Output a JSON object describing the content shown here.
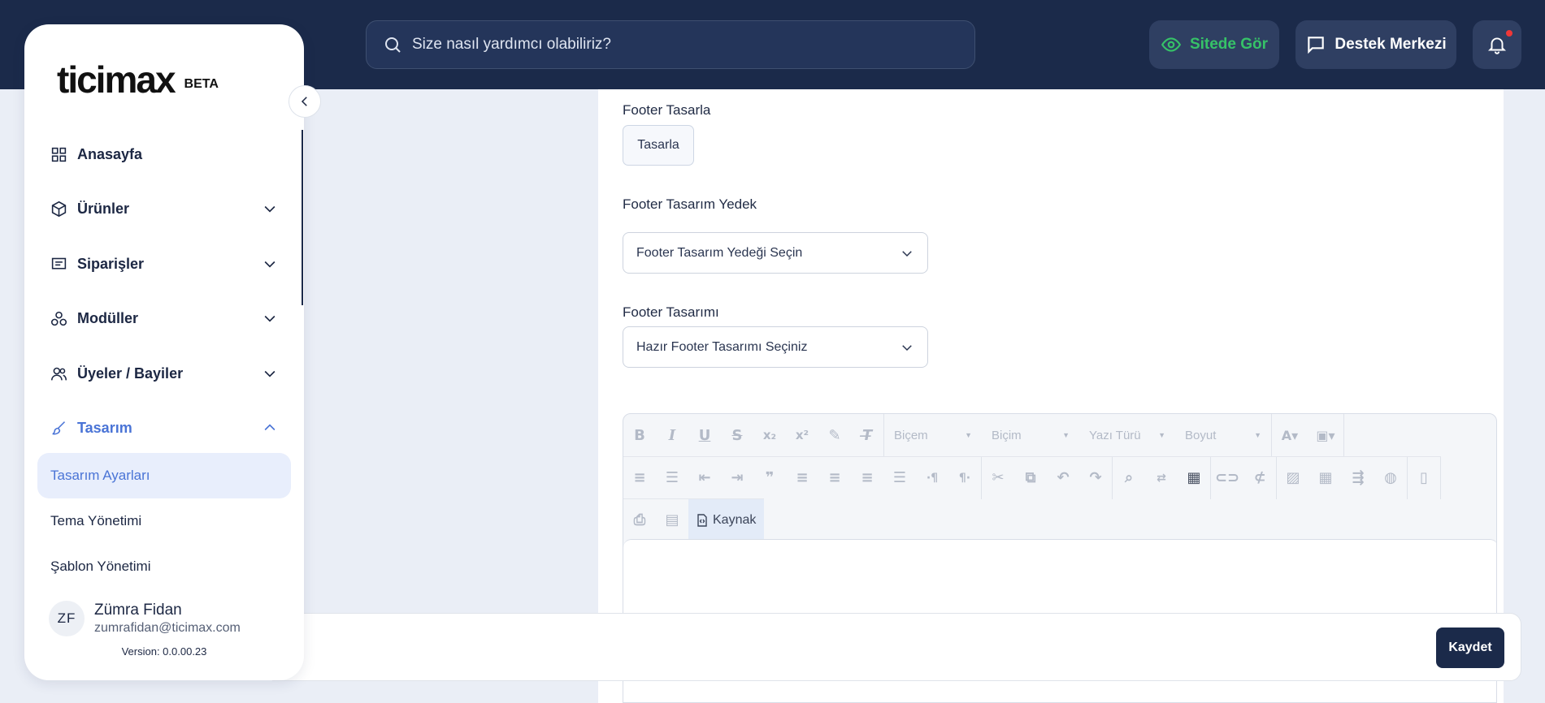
{
  "topbar": {
    "search_placeholder": "Size nasıl yardımcı olabiliriz?",
    "view_site_label": "Sitede Gör",
    "support_label": "Destek Merkezi"
  },
  "sidebar": {
    "logo_text": "ticimax",
    "beta_label": "BETA",
    "items": [
      {
        "label": "Anasayfa",
        "icon": "grid-icon",
        "expandable": false
      },
      {
        "label": "Ürünler",
        "icon": "box-icon",
        "expandable": true
      },
      {
        "label": "Siparişler",
        "icon": "list-icon",
        "expandable": true
      },
      {
        "label": "Modüller",
        "icon": "modules-icon",
        "expandable": true
      },
      {
        "label": "Üyeler / Bayiler",
        "icon": "users-icon",
        "expandable": true
      },
      {
        "label": "Tasarım",
        "icon": "brush-icon",
        "expandable": true,
        "expanded": true
      }
    ],
    "sub_items": [
      {
        "label": "Tasarım Ayarları",
        "active": true
      },
      {
        "label": "Tema Yönetimi",
        "active": false
      },
      {
        "label": "Şablon Yönetimi",
        "active": false
      }
    ],
    "user": {
      "initials": "ZF",
      "name": "Zümra Fidan",
      "email": "zumrafidan@ticimax.com"
    },
    "version": "Version: 0.0.00.23"
  },
  "form": {
    "footer_design_label": "Footer Tasarla",
    "design_button": "Tasarla",
    "backup_label": "Footer Tasarım Yedek",
    "backup_select": "Footer Tasarım Yedeği Seçin",
    "template_label": "Footer Tasarımı",
    "template_select": "Hazır Footer Tasarımı Seçiniz"
  },
  "editor": {
    "format_label": "Biçem",
    "paragraph_label": "Biçim",
    "font_label": "Yazı Türü",
    "size_label": "Boyut",
    "source_label": "Kaynak"
  },
  "actions": {
    "save_label": "Kaydet"
  },
  "colors": {
    "navy": "#1b2a4a",
    "accent": "#4a74d6",
    "green": "#36c268",
    "background": "#eaeef6"
  }
}
